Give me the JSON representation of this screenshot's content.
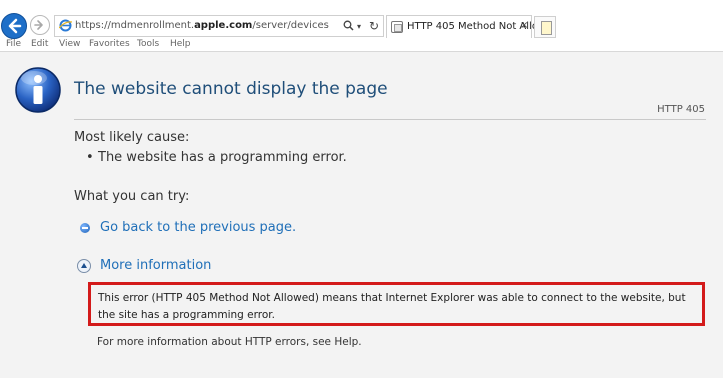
{
  "browser": {
    "url_prefix": "https://mdmenrollment.",
    "url_domain": "apple.com",
    "url_path": "/server/devices",
    "tab_title": "HTTP 405 Method Not Allo...",
    "tab_close": "×",
    "menu": [
      "File",
      "Edit",
      "View",
      "Favorites",
      "Tools",
      "Help"
    ]
  },
  "page": {
    "title": "The website cannot display the page",
    "http_code": "HTTP 405",
    "cause_heading": "Most likely cause:",
    "cause_item": "The website has a programming error.",
    "try_heading": "What you can try:",
    "back_link": "Go back to the previous page.",
    "more_info": "More information",
    "error_text": "This error (HTTP 405 Method Not Allowed) means that Internet Explorer was able to connect to the website, but the site has a programming error.",
    "help_text": "For more information about HTTP errors, see Help."
  },
  "colors": {
    "title": "#1f4e79",
    "link": "#1f6fb8",
    "highlight_border": "#d31a1a"
  }
}
